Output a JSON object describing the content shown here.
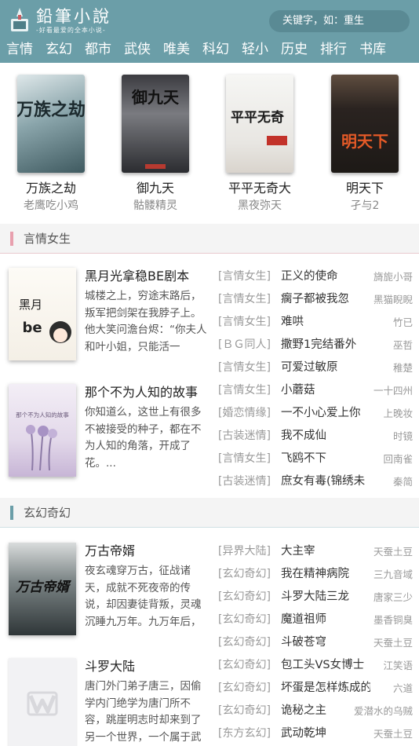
{
  "header": {
    "logo_title": "鉛筆小說",
    "logo_subtitle": "-好看最爱的全本小说-",
    "search_placeholder": "关键字，如：重生"
  },
  "nav": [
    "言情",
    "玄幻",
    "都市",
    "武侠",
    "唯美",
    "科幻",
    "轻小",
    "历史",
    "排行",
    "书库"
  ],
  "featured": [
    {
      "title": "万族之劫",
      "author": "老鹰吃小鸡",
      "cover_text": "万族之劫"
    },
    {
      "title": "御九天",
      "author": "骷髅精灵",
      "cover_text": "御九天"
    },
    {
      "title": "平平无奇大",
      "author": "黑夜弥天",
      "cover_text": "平平无奇"
    },
    {
      "title": "明天下",
      "author": "孑与2",
      "cover_text": "明天下"
    }
  ],
  "sections": [
    {
      "title": "言情女生",
      "accent": "#e8a0ae",
      "books": [
        {
          "title": "黑月光拿稳BE剧本",
          "desc": "城楼之上，穷途末路后，叛军把剑架在我脖子上。他大笑问澹台烬：“你夫人和叶小姐，只能活一",
          "cover_text": "黑月光拿稳BE剧本"
        },
        {
          "title": "那个不为人知的故事",
          "desc": "你知道么，这世上有很多不被接受的种子，都在不为人知的角落，开成了花。...",
          "cover_text": "那个不为人知的故事"
        }
      ],
      "list": [
        {
          "cat": "[言情女生]",
          "title": "正义的使命",
          "author": "旖旎小哥"
        },
        {
          "cat": "[言情女生]",
          "title": "瘸子都被我忽",
          "author": "黑猫睨睨"
        },
        {
          "cat": "[言情女生]",
          "title": "难哄",
          "author": "竹已"
        },
        {
          "cat": "[ＢＧ同人]",
          "title": "撒野1完结番外",
          "author": "巫哲"
        },
        {
          "cat": "[言情女生]",
          "title": "可爱过敏原",
          "author": "稚楚"
        },
        {
          "cat": "[言情女生]",
          "title": "小蘑菇",
          "author": "一十四州"
        },
        {
          "cat": "[婚恋情缘]",
          "title": "一不小心爱上你",
          "author": "上晚妆"
        },
        {
          "cat": "[古装迷情]",
          "title": "我不成仙",
          "author": "时镜"
        },
        {
          "cat": "[言情女生]",
          "title": "飞鸥不下",
          "author": "回南雀"
        },
        {
          "cat": "[古装迷情]",
          "title": "庶女有毒(锦绣未",
          "author": "秦简"
        }
      ]
    },
    {
      "title": "玄幻奇幻",
      "accent": "#6b9ea8",
      "books": [
        {
          "title": "万古帝婿",
          "desc": "夜玄魂穿万古，征战诸天，成就不死夜帝的传说，却因妻徒背叛，灵魂沉睡九万年。九万年后，",
          "cover_text": "万古帝婿"
        },
        {
          "title": "斗罗大陆",
          "desc": "唐门外门弟子唐三，因偷学内门绝学为唐门所不容，跳崖明志时却来到了另一个世界，一个属于武",
          "cover_text": ""
        }
      ],
      "list": [
        {
          "cat": "[异界大陆]",
          "title": "大主宰",
          "author": "天蚕土豆"
        },
        {
          "cat": "[玄幻奇幻]",
          "title": "我在精神病院",
          "author": "三九音域"
        },
        {
          "cat": "[玄幻奇幻]",
          "title": "斗罗大陆三龙",
          "author": "唐家三少"
        },
        {
          "cat": "[玄幻奇幻]",
          "title": "魔道祖师",
          "author": "墨香铜臭"
        },
        {
          "cat": "[玄幻奇幻]",
          "title": "斗破苍穹",
          "author": "天蚕土豆"
        },
        {
          "cat": "[玄幻奇幻]",
          "title": "包工头VS女博士",
          "author": "江笑语"
        },
        {
          "cat": "[玄幻奇幻]",
          "title": "坏蛋是怎样炼成的",
          "author": "六道"
        },
        {
          "cat": "[玄幻奇幻]",
          "title": "诡秘之主",
          "author": "爱潜水的乌贼"
        },
        {
          "cat": "[东方玄幻]",
          "title": "武动乾坤",
          "author": "天蚕土豆"
        }
      ]
    }
  ]
}
